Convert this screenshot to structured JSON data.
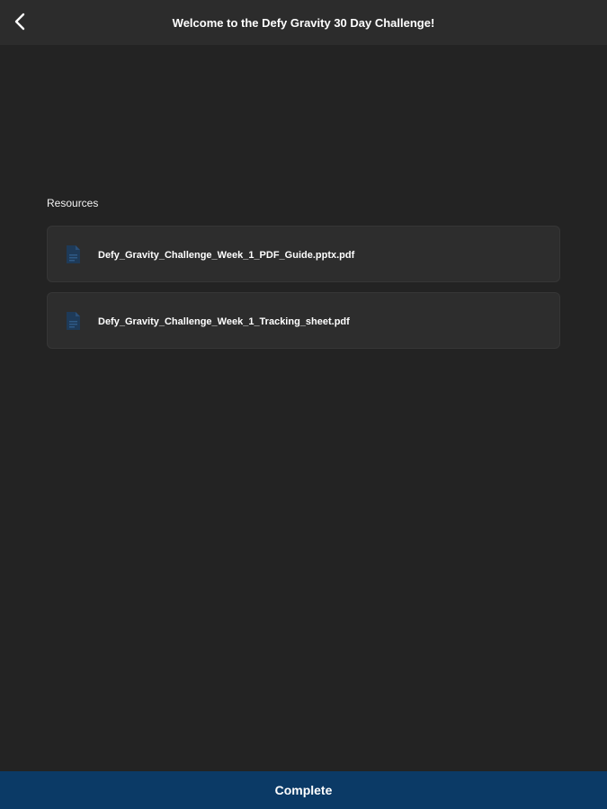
{
  "header": {
    "back_icon": "chevron-left-icon",
    "title": "Welcome to the Defy Gravity 30 Day Challenge!"
  },
  "resources": {
    "title": "Resources",
    "items": [
      {
        "name": "Defy_Gravity_Challenge_Week_1_PDF_Guide.pptx.pdf",
        "icon": "document-icon"
      },
      {
        "name": "Defy_Gravity_Challenge_Week_1_Tracking_sheet.pdf",
        "icon": "document-icon"
      }
    ]
  },
  "footer": {
    "complete_label": "Complete"
  },
  "colors": {
    "background": "#232323",
    "header": "#2c2c2c",
    "card": "#2d2d2d",
    "accent": "#0b3a66",
    "icon": "#1b3d60"
  }
}
